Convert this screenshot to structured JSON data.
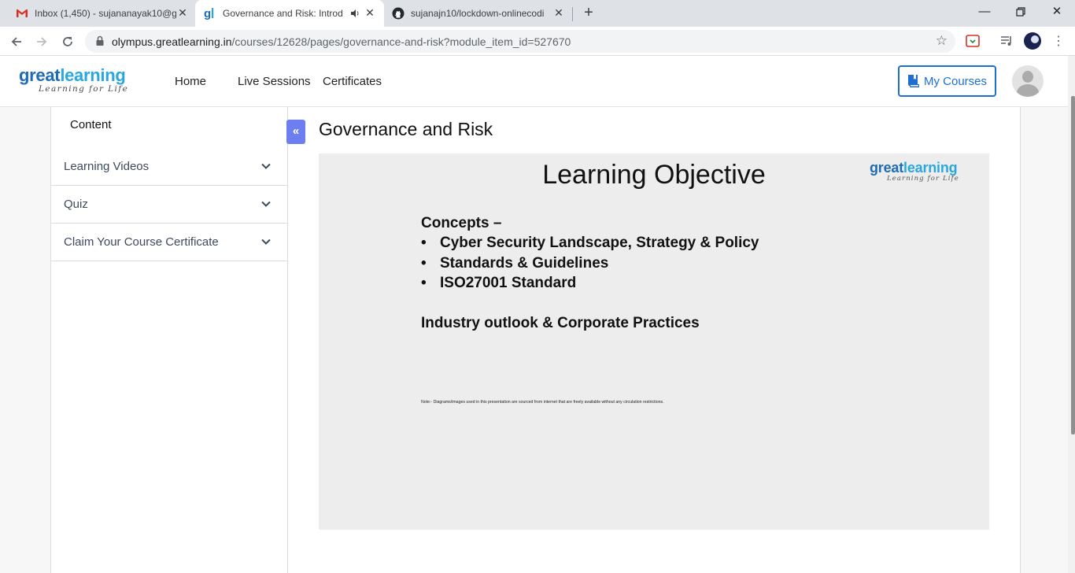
{
  "browser": {
    "tabs": [
      {
        "title": "Inbox (1,450) - sujananayak10@g",
        "favicon": "gmail-icon",
        "active": false
      },
      {
        "title": "Governance and Risk: Introdu",
        "favicon": "greatlearning-icon",
        "active": true,
        "audio": true
      },
      {
        "title": "sujanajn10/lockdown-onlinecodi",
        "favicon": "github-icon",
        "active": false
      }
    ],
    "url_host": "olympus.greatlearning.in",
    "url_path": "/courses/12628/pages/governance-and-risk?module_item_id=527670"
  },
  "header": {
    "logo_word_1": "great",
    "logo_word_2": "learning",
    "logo_tagline": "Learning for Life",
    "nav": [
      "Home",
      "Live Sessions",
      "Certificates"
    ],
    "my_courses_label": "My Courses"
  },
  "sidebar": {
    "title": "Content",
    "items": [
      {
        "label": "Learning Videos"
      },
      {
        "label": "Quiz"
      },
      {
        "label": "Claim Your Course Certificate"
      }
    ],
    "collapse_glyph": "«"
  },
  "main": {
    "title": "Governance and Risk",
    "slide": {
      "title": "Learning Objective",
      "logo_word_1": "great",
      "logo_word_2": "learning",
      "logo_tagline": "Learning for Life",
      "concepts_heading": "Concepts –",
      "bullets": [
        "Cyber Security Landscape, Strategy & Policy",
        "Standards & Guidelines",
        "ISO27001 Standard"
      ],
      "bullet_glyph": "•",
      "outlook": "Industry outlook & Corporate Practices",
      "note": "Note:- Diagrams/images used in this presentation are sourced from internet that are freely available without any circulation restrictions."
    }
  },
  "colors": {
    "brand_dark_blue": "#1e6bb8",
    "brand_light_blue": "#29a8e0",
    "accent_button": "#1f6fd1",
    "collapse_button": "#6d7ff0"
  }
}
